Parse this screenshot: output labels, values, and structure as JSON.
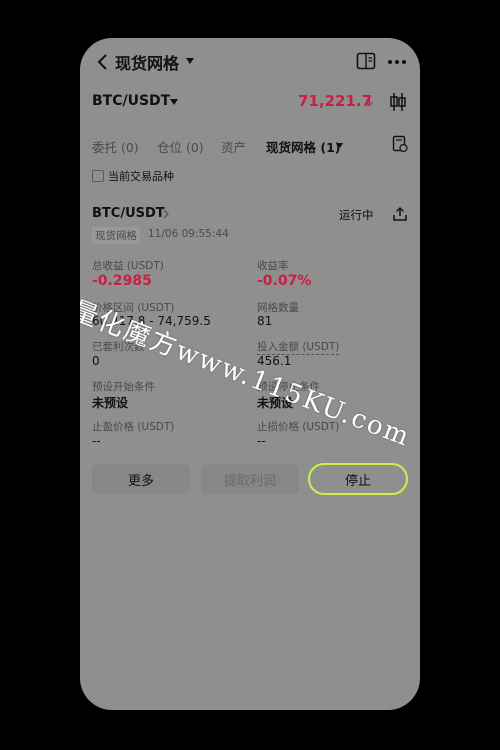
{
  "header": {
    "title": "现货网格",
    "pair": "BTC/USDT",
    "price": "71,221.7",
    "price_arrow": "↓"
  },
  "tabs": [
    {
      "label": "委托 (0)"
    },
    {
      "label": "仓位 (0)"
    },
    {
      "label": "资产"
    },
    {
      "label": "现货网格 (1)",
      "active": true
    }
  ],
  "filter": {
    "checkbox_label": "当前交易品种"
  },
  "card": {
    "pair": "BTC/USDT",
    "status": "运行中",
    "tag": "现货网格",
    "time": "11/06 09:55:44",
    "total_profit_label": "总收益 (USDT)",
    "total_profit_value": "-0.2985",
    "yield_label": "收益率",
    "yield_value": "-0.07%",
    "range_label": "价格区间 (USDT)",
    "range_value": "60,417.8 - 74,759.5",
    "grids_label": "网格数量",
    "grids_value": "81",
    "arb_label": "已套利次数",
    "arb_value": "0",
    "investment_label": "投入金额 (USDT)",
    "investment_value": "456.1",
    "start_label": "预设开始条件",
    "start_value": "未预设",
    "stop_label": "预设停止条件",
    "stop_value": "未预设",
    "tp_label": "止盈价格 (USDT)",
    "tp_value": "--",
    "sl_label": "止损价格 (USDT)",
    "sl_value": "--"
  },
  "actions": {
    "more": "更多",
    "withdraw": "提取利润",
    "stop": "停止"
  },
  "watermark": "量化魔方www.115KU.com",
  "colors": {
    "accent_red": "#c82044",
    "stop_border": "#c6f24a",
    "overlay": "#8f8f8f"
  }
}
